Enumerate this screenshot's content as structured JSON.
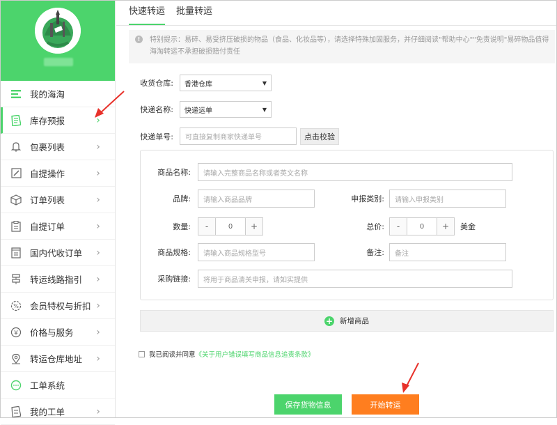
{
  "sidebar": {
    "items": [
      {
        "label": "我的海淘",
        "icon": "list-icon"
      },
      {
        "label": "库存预报",
        "icon": "document-icon"
      },
      {
        "label": "包裹列表",
        "icon": "bell-icon"
      },
      {
        "label": "自提操作",
        "icon": "edit-icon"
      },
      {
        "label": "订单列表",
        "icon": "box-icon"
      },
      {
        "label": "自提订单",
        "icon": "clipboard-icon"
      },
      {
        "label": "国内代收订单",
        "icon": "receipt-icon"
      },
      {
        "label": "转运线路指引",
        "icon": "route-icon"
      },
      {
        "label": "会员特权与折扣",
        "icon": "discount-icon"
      },
      {
        "label": "价格与服务",
        "icon": "yen-icon"
      },
      {
        "label": "转运仓库地址",
        "icon": "location-icon"
      },
      {
        "label": "工单系统",
        "icon": "chat-icon"
      },
      {
        "label": "我的工单",
        "icon": "ticket-icon"
      }
    ]
  },
  "tabs": [
    "快速转运",
    "批量转运"
  ],
  "notice": "特别提示：易碎、易受挤压破损的物品（食品、化妆品等），请选择特殊加固服务，并仔细阅读\"帮助中心\"\"免责说明\"易碎物品值得海淘转运不承担破损赔付责任",
  "form": {
    "warehouse_label": "收货仓库:",
    "warehouse_value": "香港仓库",
    "courier_label": "快递名称:",
    "courier_value": "快递运单",
    "tracking_label": "快递单号:",
    "tracking_placeholder": "可直接复制商家快递单号",
    "check_button": "点击校验"
  },
  "product": {
    "name_label": "商品名称:",
    "name_placeholder": "请输入完整商品名称或者英文名称",
    "brand_label": "品牌:",
    "brand_placeholder": "请输入商品品牌",
    "category_label": "申报类别:",
    "category_placeholder": "请输入申报类别",
    "qty_label": "数量:",
    "qty_value": "0",
    "total_label": "总价:",
    "total_value": "0",
    "currency": "美金",
    "spec_label": "商品规格:",
    "spec_placeholder": "请输入商品规格型号",
    "remark_label": "备注:",
    "remark_placeholder": "备注",
    "link_label": "采购链接:",
    "link_placeholder": "将用于商品清关申报，请如实提供",
    "minus": "-",
    "plus": "+"
  },
  "add_product": "新增商品",
  "agree_text": "我已阅读并同意",
  "agree_link": "《关于用户错误填写商品信息追责条款》",
  "buttons": {
    "save": "保存货物信息",
    "start": "开始转运"
  },
  "colors": {
    "accent": "#4cd46c",
    "orange": "#ff7e1f",
    "arrow": "#e8322b"
  }
}
